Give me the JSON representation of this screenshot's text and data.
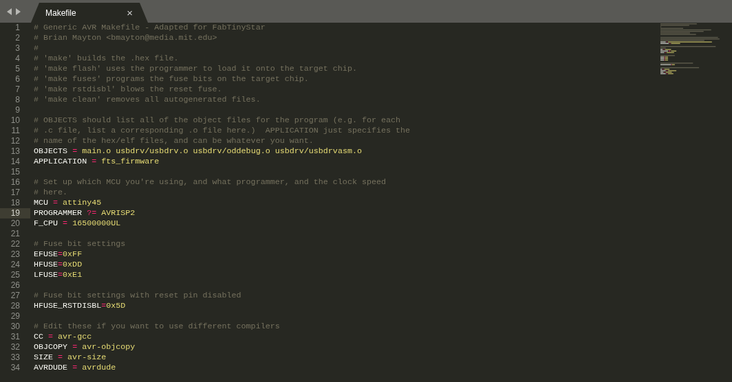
{
  "tabs": [
    {
      "label": "Makefile",
      "close": "×",
      "selected": true
    }
  ],
  "editor": {
    "lines": [
      {
        "number": "1",
        "current": false,
        "tokens": [
          {
            "kind": "comment",
            "text": "# Generic AVR Makefile - Adapted for FabTinyStar"
          }
        ]
      },
      {
        "number": "2",
        "current": false,
        "tokens": [
          {
            "kind": "comment",
            "text": "# Brian Mayton <bmayton@media.mit.edu>"
          }
        ]
      },
      {
        "number": "3",
        "current": false,
        "tokens": [
          {
            "kind": "comment",
            "text": "#"
          }
        ]
      },
      {
        "number": "4",
        "current": false,
        "tokens": [
          {
            "kind": "comment",
            "text": "# 'make' builds the .hex file."
          }
        ]
      },
      {
        "number": "5",
        "current": false,
        "tokens": [
          {
            "kind": "comment",
            "text": "# 'make flash' uses the programmer to load it onto the target chip."
          }
        ]
      },
      {
        "number": "6",
        "current": false,
        "tokens": [
          {
            "kind": "comment",
            "text": "# 'make fuses' programs the fuse bits on the target chip."
          }
        ]
      },
      {
        "number": "7",
        "current": false,
        "tokens": [
          {
            "kind": "comment",
            "text": "# 'make rstdisbl' blows the reset fuse."
          }
        ]
      },
      {
        "number": "8",
        "current": false,
        "tokens": [
          {
            "kind": "comment",
            "text": "# 'make clean' removes all autogenerated files."
          }
        ]
      },
      {
        "number": "9",
        "current": false
      },
      {
        "number": "10",
        "current": false,
        "tokens": [
          {
            "kind": "comment",
            "text": "# OBJECTS should list all of the object files for the program (e.g. for each"
          }
        ]
      },
      {
        "number": "11",
        "current": false,
        "tokens": [
          {
            "kind": "comment",
            "text": "# .c file, list a corresponding .o file here.)  APPLICATION just specifies the"
          }
        ]
      },
      {
        "number": "12",
        "current": false,
        "tokens": [
          {
            "kind": "comment",
            "text": "# name of the hex/elf files, and can be whatever you want."
          }
        ]
      },
      {
        "number": "13",
        "current": false,
        "tokens": [
          {
            "kind": "variable",
            "text": "OBJECTS"
          },
          {
            "kind": "operator",
            "text": "=",
            "spaced": true
          },
          {
            "kind": "value",
            "text": "main.o usbdrv/usbdrv.o usbdrv/oddebug.o usbdrv/usbdrvasm.o"
          }
        ]
      },
      {
        "number": "14",
        "current": false,
        "tokens": [
          {
            "kind": "variable",
            "text": "APPLICATION"
          },
          {
            "kind": "operator",
            "text": "=",
            "spaced": true
          },
          {
            "kind": "value",
            "text": "fts_firmware"
          }
        ]
      },
      {
        "number": "15",
        "current": false
      },
      {
        "number": "16",
        "current": false,
        "tokens": [
          {
            "kind": "comment",
            "text": "# Set up which MCU you're using, and what programmer, and the clock speed"
          }
        ]
      },
      {
        "number": "17",
        "current": false,
        "tokens": [
          {
            "kind": "comment",
            "text": "# here."
          }
        ]
      },
      {
        "number": "18",
        "current": false,
        "tokens": [
          {
            "kind": "variable",
            "text": "MCU"
          },
          {
            "kind": "operator",
            "text": "=",
            "spaced": true
          },
          {
            "kind": "value",
            "text": "attiny45"
          }
        ]
      },
      {
        "number": "19",
        "current": true,
        "tokens": [
          {
            "kind": "variable",
            "text": "PROGRAMMER"
          },
          {
            "kind": "operator",
            "text": "?=",
            "spaced": true
          },
          {
            "kind": "value",
            "text": "AVRISP2"
          }
        ]
      },
      {
        "number": "20",
        "current": false,
        "tokens": [
          {
            "kind": "variable",
            "text": "F_CPU"
          },
          {
            "kind": "operator",
            "text": "=",
            "spaced": true
          },
          {
            "kind": "value",
            "text": "16500000UL"
          }
        ]
      },
      {
        "number": "21",
        "current": false
      },
      {
        "number": "22",
        "current": false,
        "tokens": [
          {
            "kind": "comment",
            "text": "# Fuse bit settings"
          }
        ]
      },
      {
        "number": "23",
        "current": false,
        "tokens": [
          {
            "kind": "variable",
            "text": "EFUSE"
          },
          {
            "kind": "operator",
            "text": "=",
            "spaced": false
          },
          {
            "kind": "value",
            "text": "0xFF"
          }
        ]
      },
      {
        "number": "24",
        "current": false,
        "tokens": [
          {
            "kind": "variable",
            "text": "HFUSE"
          },
          {
            "kind": "operator",
            "text": "=",
            "spaced": false
          },
          {
            "kind": "value",
            "text": "0xDD"
          }
        ]
      },
      {
        "number": "25",
        "current": false,
        "tokens": [
          {
            "kind": "variable",
            "text": "LFUSE"
          },
          {
            "kind": "operator",
            "text": "=",
            "spaced": false
          },
          {
            "kind": "value",
            "text": "0xE1"
          }
        ]
      },
      {
        "number": "26",
        "current": false
      },
      {
        "number": "27",
        "current": false,
        "tokens": [
          {
            "kind": "comment",
            "text": "# Fuse bit settings with reset pin disabled"
          }
        ]
      },
      {
        "number": "28",
        "current": false,
        "tokens": [
          {
            "kind": "variable",
            "text": "HFUSE_RSTDISBL"
          },
          {
            "kind": "operator",
            "text": "=",
            "spaced": false
          },
          {
            "kind": "value",
            "text": "0x5D"
          }
        ]
      },
      {
        "number": "29",
        "current": false
      },
      {
        "number": "30",
        "current": false,
        "tokens": [
          {
            "kind": "comment",
            "text": "# Edit these if you want to use different compilers"
          }
        ]
      },
      {
        "number": "31",
        "current": false,
        "tokens": [
          {
            "kind": "variable",
            "text": "CC"
          },
          {
            "kind": "operator",
            "text": "=",
            "spaced": true
          },
          {
            "kind": "value",
            "text": "avr-gcc"
          }
        ]
      },
      {
        "number": "32",
        "current": false,
        "tokens": [
          {
            "kind": "variable",
            "text": "OBJCOPY"
          },
          {
            "kind": "operator",
            "text": "=",
            "spaced": true
          },
          {
            "kind": "value",
            "text": "avr-objcopy"
          }
        ]
      },
      {
        "number": "33",
        "current": false,
        "tokens": [
          {
            "kind": "variable",
            "text": "SIZE"
          },
          {
            "kind": "operator",
            "text": "=",
            "spaced": true
          },
          {
            "kind": "value",
            "text": "avr-size"
          }
        ]
      },
      {
        "number": "34",
        "current": false,
        "tokens": [
          {
            "kind": "variable",
            "text": "AVRDUDE"
          },
          {
            "kind": "operator",
            "text": "=",
            "spaced": true
          },
          {
            "kind": "value",
            "text": "avrdude"
          }
        ]
      }
    ]
  }
}
